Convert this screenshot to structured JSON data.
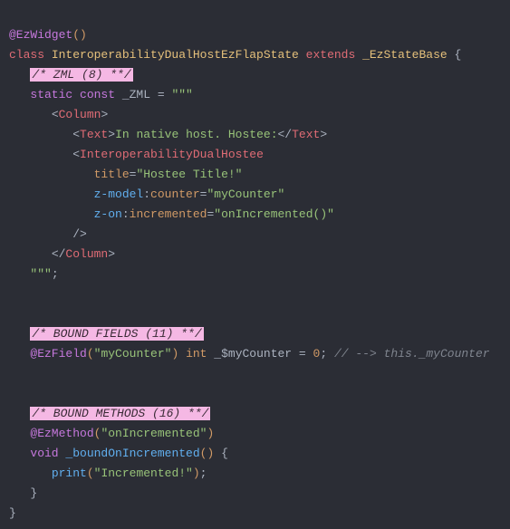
{
  "line1": {
    "decorator": "@EzWidget",
    "paren": "()"
  },
  "line2": {
    "class_kw": "class ",
    "name": "InteroperabilityDualHostEzFlapState",
    "extends_kw": " extends ",
    "base": "_EzStateBase",
    "brace": " {"
  },
  "line3": {
    "comment": "/* ZML (8) **/"
  },
  "line4": {
    "static": "static ",
    "const": "const ",
    "var": "_ZML",
    "eq": " = ",
    "triple": "\"\"\""
  },
  "line5": {
    "open": "<",
    "tag": "Column",
    "close": ">"
  },
  "line6": {
    "open": "<",
    "tag": "Text",
    "close": ">",
    "text": "In native host. Hostee:",
    "open2": "</",
    "close2": ">"
  },
  "line7": {
    "open": "<",
    "tag": "InteroperabilityDualHostee"
  },
  "line8": {
    "attr": "title",
    "eq": "=",
    "val": "\"Hostee Title!\""
  },
  "line9": {
    "ns": "z-model",
    "colon": ":",
    "attr": "counter",
    "eq": "=",
    "val": "\"myCounter\""
  },
  "line10": {
    "ns": "z-on",
    "colon": ":",
    "attr": "incremented",
    "eq": "=",
    "val": "\"onIncremented()\""
  },
  "line11": {
    "selfclose": "/>"
  },
  "line12": {
    "open": "</",
    "tag": "Column",
    "close": ">"
  },
  "line13": {
    "triple": "\"\"\"",
    "semi": ";"
  },
  "line14": {
    "comment": "/* BOUND FIELDS (11) **/"
  },
  "line15": {
    "deco": "@EzField",
    "open": "(",
    "str": "\"myCounter\"",
    "close": ")",
    "type": " int ",
    "var": "_$myCounter",
    "eq": " = ",
    "num": "0",
    "semi": ";",
    "comment": " // --> this._myCounter"
  },
  "line16": {
    "comment": "/* BOUND METHODS (16) **/"
  },
  "line17": {
    "deco": "@EzMethod",
    "open": "(",
    "str": "\"onIncremented\"",
    "close": ")"
  },
  "line18": {
    "void": "void ",
    "fn": "_boundOnIncremented",
    "paren": "()",
    "brace": " {"
  },
  "line19": {
    "fn": "print",
    "open": "(",
    "str": "\"Incremented!\"",
    "close": ")",
    "semi": ";"
  },
  "line20": {
    "brace": "}"
  },
  "line21": {
    "brace": "}"
  }
}
